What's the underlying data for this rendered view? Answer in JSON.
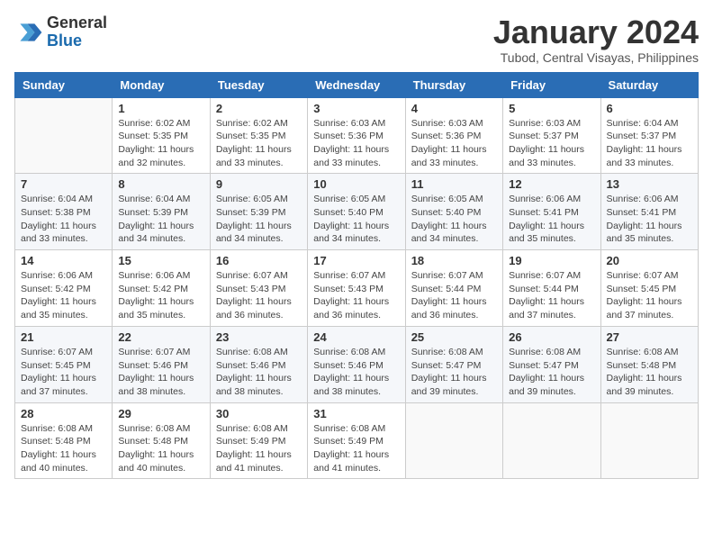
{
  "logo": {
    "general": "General",
    "blue": "Blue"
  },
  "title": "January 2024",
  "subtitle": "Tubod, Central Visayas, Philippines",
  "days_header": [
    "Sunday",
    "Monday",
    "Tuesday",
    "Wednesday",
    "Thursday",
    "Friday",
    "Saturday"
  ],
  "weeks": [
    [
      {
        "day": "",
        "sunrise": "",
        "sunset": "",
        "daylight": ""
      },
      {
        "day": "1",
        "sunrise": "Sunrise: 6:02 AM",
        "sunset": "Sunset: 5:35 PM",
        "daylight": "Daylight: 11 hours and 32 minutes."
      },
      {
        "day": "2",
        "sunrise": "Sunrise: 6:02 AM",
        "sunset": "Sunset: 5:35 PM",
        "daylight": "Daylight: 11 hours and 33 minutes."
      },
      {
        "day": "3",
        "sunrise": "Sunrise: 6:03 AM",
        "sunset": "Sunset: 5:36 PM",
        "daylight": "Daylight: 11 hours and 33 minutes."
      },
      {
        "day": "4",
        "sunrise": "Sunrise: 6:03 AM",
        "sunset": "Sunset: 5:36 PM",
        "daylight": "Daylight: 11 hours and 33 minutes."
      },
      {
        "day": "5",
        "sunrise": "Sunrise: 6:03 AM",
        "sunset": "Sunset: 5:37 PM",
        "daylight": "Daylight: 11 hours and 33 minutes."
      },
      {
        "day": "6",
        "sunrise": "Sunrise: 6:04 AM",
        "sunset": "Sunset: 5:37 PM",
        "daylight": "Daylight: 11 hours and 33 minutes."
      }
    ],
    [
      {
        "day": "7",
        "sunrise": "Sunrise: 6:04 AM",
        "sunset": "Sunset: 5:38 PM",
        "daylight": "Daylight: 11 hours and 33 minutes."
      },
      {
        "day": "8",
        "sunrise": "Sunrise: 6:04 AM",
        "sunset": "Sunset: 5:39 PM",
        "daylight": "Daylight: 11 hours and 34 minutes."
      },
      {
        "day": "9",
        "sunrise": "Sunrise: 6:05 AM",
        "sunset": "Sunset: 5:39 PM",
        "daylight": "Daylight: 11 hours and 34 minutes."
      },
      {
        "day": "10",
        "sunrise": "Sunrise: 6:05 AM",
        "sunset": "Sunset: 5:40 PM",
        "daylight": "Daylight: 11 hours and 34 minutes."
      },
      {
        "day": "11",
        "sunrise": "Sunrise: 6:05 AM",
        "sunset": "Sunset: 5:40 PM",
        "daylight": "Daylight: 11 hours and 34 minutes."
      },
      {
        "day": "12",
        "sunrise": "Sunrise: 6:06 AM",
        "sunset": "Sunset: 5:41 PM",
        "daylight": "Daylight: 11 hours and 35 minutes."
      },
      {
        "day": "13",
        "sunrise": "Sunrise: 6:06 AM",
        "sunset": "Sunset: 5:41 PM",
        "daylight": "Daylight: 11 hours and 35 minutes."
      }
    ],
    [
      {
        "day": "14",
        "sunrise": "Sunrise: 6:06 AM",
        "sunset": "Sunset: 5:42 PM",
        "daylight": "Daylight: 11 hours and 35 minutes."
      },
      {
        "day": "15",
        "sunrise": "Sunrise: 6:06 AM",
        "sunset": "Sunset: 5:42 PM",
        "daylight": "Daylight: 11 hours and 35 minutes."
      },
      {
        "day": "16",
        "sunrise": "Sunrise: 6:07 AM",
        "sunset": "Sunset: 5:43 PM",
        "daylight": "Daylight: 11 hours and 36 minutes."
      },
      {
        "day": "17",
        "sunrise": "Sunrise: 6:07 AM",
        "sunset": "Sunset: 5:43 PM",
        "daylight": "Daylight: 11 hours and 36 minutes."
      },
      {
        "day": "18",
        "sunrise": "Sunrise: 6:07 AM",
        "sunset": "Sunset: 5:44 PM",
        "daylight": "Daylight: 11 hours and 36 minutes."
      },
      {
        "day": "19",
        "sunrise": "Sunrise: 6:07 AM",
        "sunset": "Sunset: 5:44 PM",
        "daylight": "Daylight: 11 hours and 37 minutes."
      },
      {
        "day": "20",
        "sunrise": "Sunrise: 6:07 AM",
        "sunset": "Sunset: 5:45 PM",
        "daylight": "Daylight: 11 hours and 37 minutes."
      }
    ],
    [
      {
        "day": "21",
        "sunrise": "Sunrise: 6:07 AM",
        "sunset": "Sunset: 5:45 PM",
        "daylight": "Daylight: 11 hours and 37 minutes."
      },
      {
        "day": "22",
        "sunrise": "Sunrise: 6:07 AM",
        "sunset": "Sunset: 5:46 PM",
        "daylight": "Daylight: 11 hours and 38 minutes."
      },
      {
        "day": "23",
        "sunrise": "Sunrise: 6:08 AM",
        "sunset": "Sunset: 5:46 PM",
        "daylight": "Daylight: 11 hours and 38 minutes."
      },
      {
        "day": "24",
        "sunrise": "Sunrise: 6:08 AM",
        "sunset": "Sunset: 5:46 PM",
        "daylight": "Daylight: 11 hours and 38 minutes."
      },
      {
        "day": "25",
        "sunrise": "Sunrise: 6:08 AM",
        "sunset": "Sunset: 5:47 PM",
        "daylight": "Daylight: 11 hours and 39 minutes."
      },
      {
        "day": "26",
        "sunrise": "Sunrise: 6:08 AM",
        "sunset": "Sunset: 5:47 PM",
        "daylight": "Daylight: 11 hours and 39 minutes."
      },
      {
        "day": "27",
        "sunrise": "Sunrise: 6:08 AM",
        "sunset": "Sunset: 5:48 PM",
        "daylight": "Daylight: 11 hours and 39 minutes."
      }
    ],
    [
      {
        "day": "28",
        "sunrise": "Sunrise: 6:08 AM",
        "sunset": "Sunset: 5:48 PM",
        "daylight": "Daylight: 11 hours and 40 minutes."
      },
      {
        "day": "29",
        "sunrise": "Sunrise: 6:08 AM",
        "sunset": "Sunset: 5:48 PM",
        "daylight": "Daylight: 11 hours and 40 minutes."
      },
      {
        "day": "30",
        "sunrise": "Sunrise: 6:08 AM",
        "sunset": "Sunset: 5:49 PM",
        "daylight": "Daylight: 11 hours and 41 minutes."
      },
      {
        "day": "31",
        "sunrise": "Sunrise: 6:08 AM",
        "sunset": "Sunset: 5:49 PM",
        "daylight": "Daylight: 11 hours and 41 minutes."
      },
      {
        "day": "",
        "sunrise": "",
        "sunset": "",
        "daylight": ""
      },
      {
        "day": "",
        "sunrise": "",
        "sunset": "",
        "daylight": ""
      },
      {
        "day": "",
        "sunrise": "",
        "sunset": "",
        "daylight": ""
      }
    ]
  ]
}
